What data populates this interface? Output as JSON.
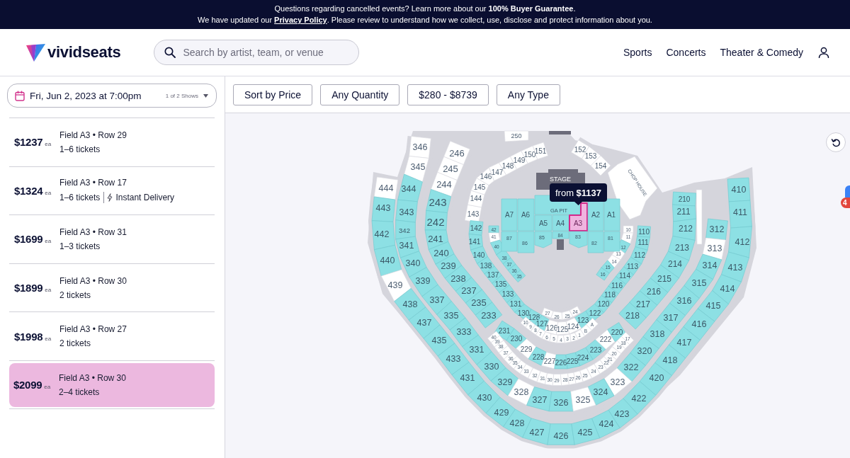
{
  "banner": {
    "message": "Questions regarding cancelled events? Learn more about our **100% Buyer Guarantee**.",
    "notice": {
      "before": "We have updated our ",
      "link": "Privacy Policy",
      "after": ". Please review to understand how we collect, use, disclose and protect information about you."
    }
  },
  "header": {
    "logo": "vividseats",
    "search": {
      "placeholder": "Search by artist, team, or venue"
    },
    "nav": [
      "Sports",
      "Concerts",
      "Theater & Comedy"
    ]
  },
  "event_selector": {
    "date": "Fri, Jun 2, 2023 at 7:00pm",
    "shows": "1 of 2 Shows"
  },
  "listings": [
    {
      "price": "$1237",
      "unit": "ea",
      "seat": "Field A3 • Row 29",
      "quantity": "1–6 tickets",
      "selected": false
    },
    {
      "price": "$1324",
      "unit": "ea",
      "seat": "Field A3 • Row 17",
      "quantity": "1–6 tickets",
      "feature": "Instant Delivery",
      "selected": false
    },
    {
      "price": "$1699",
      "unit": "ea",
      "seat": "Field A3 • Row 31",
      "quantity": "1–3 tickets",
      "selected": false
    },
    {
      "price": "$1899",
      "unit": "ea",
      "seat": "Field A3 • Row 30",
      "quantity": "2 tickets",
      "selected": false
    },
    {
      "price": "$1998",
      "unit": "ea",
      "seat": "Field A3 • Row 27",
      "quantity": "2 tickets",
      "selected": false
    },
    {
      "price": "$2099",
      "unit": "ea",
      "seat": "Field A3 • Row 30",
      "quantity": "2–4 tickets",
      "selected": true
    }
  ],
  "filters": [
    "Sort by Price",
    "Any Quantity",
    "$280 - $8739",
    "Any Type"
  ],
  "seat_map": {
    "levels": [
      {
        "sections": [
          {
            "label": "444",
            "available": false
          },
          {
            "label": "443",
            "available": true
          },
          {
            "label": "442",
            "available": true
          },
          {
            "label": "440",
            "available": true
          },
          {
            "label": "439",
            "available": false
          },
          {
            "label": "438",
            "available": true
          },
          {
            "label": "437",
            "available": true
          },
          {
            "label": "435",
            "available": true
          },
          {
            "label": "433",
            "available": true
          },
          {
            "label": "431",
            "available": true
          },
          {
            "label": "430",
            "available": true
          },
          {
            "label": "429",
            "available": true
          },
          {
            "label": "428",
            "available": true
          },
          {
            "label": "427",
            "available": true
          },
          {
            "label": "426",
            "available": true
          },
          {
            "label": "410",
            "available": true
          },
          {
            "label": "411",
            "available": true
          },
          {
            "label": "412",
            "available": true
          },
          {
            "label": "413",
            "available": true
          },
          {
            "label": "414",
            "available": true
          },
          {
            "label": "415",
            "available": true
          },
          {
            "label": "416",
            "available": true
          },
          {
            "label": "417",
            "available": true
          },
          {
            "label": "418",
            "available": true
          },
          {
            "label": "420",
            "available": true
          },
          {
            "label": "422",
            "available": true
          },
          {
            "label": "423",
            "available": true
          },
          {
            "label": "424",
            "available": true
          },
          {
            "label": "425",
            "available": true
          }
        ]
      },
      {
        "sections": [
          {
            "label": "346",
            "available": false
          },
          {
            "label": "345",
            "available": false
          },
          {
            "label": "344",
            "available": true
          },
          {
            "label": "343",
            "available": true
          },
          {
            "label": "342",
            "available": true
          },
          {
            "label": "341",
            "available": true
          },
          {
            "label": "340",
            "available": true
          },
          {
            "label": "339",
            "available": true
          },
          {
            "label": "337",
            "available": true
          },
          {
            "label": "335",
            "available": true
          },
          {
            "label": "333",
            "available": true
          },
          {
            "label": "331",
            "available": true
          },
          {
            "label": "330",
            "available": true
          },
          {
            "label": "329",
            "available": true
          },
          {
            "label": "328",
            "available": false
          },
          {
            "label": "327",
            "available": true
          },
          {
            "label": "326",
            "available": true
          },
          {
            "label": "312",
            "available": true
          },
          {
            "label": "313",
            "available": false
          },
          {
            "label": "314",
            "available": true
          },
          {
            "label": "315",
            "available": true
          },
          {
            "label": "316",
            "available": true
          },
          {
            "label": "317",
            "available": true
          },
          {
            "label": "318",
            "available": true
          },
          {
            "label": "320",
            "available": true
          },
          {
            "label": "322",
            "available": true
          },
          {
            "label": "323",
            "available": false
          },
          {
            "label": "324",
            "available": true
          },
          {
            "label": "325",
            "available": false
          }
        ]
      },
      {
        "sections": [
          {
            "label": "246",
            "available": false
          },
          {
            "label": "245",
            "available": false
          },
          {
            "label": "244",
            "available": false
          },
          {
            "label": "243",
            "available": true
          },
          {
            "label": "242",
            "available": true
          },
          {
            "label": "241",
            "available": true
          },
          {
            "label": "240",
            "available": true
          },
          {
            "label": "239",
            "available": true
          },
          {
            "label": "238",
            "available": true
          },
          {
            "label": "237",
            "available": true
          },
          {
            "label": "235",
            "available": true
          },
          {
            "label": "233",
            "available": true
          }
        ]
      },
      {
        "sections": [
          {
            "label": "210",
            "available": true
          },
          {
            "label": "211",
            "available": true
          },
          {
            "label": "212",
            "available": true
          },
          {
            "label": "213",
            "available": true
          },
          {
            "label": "214",
            "available": true
          },
          {
            "label": "215",
            "available": true
          },
          {
            "label": "216",
            "available": true
          },
          {
            "label": "217",
            "available": true
          },
          {
            "label": "218",
            "available": true
          }
        ]
      },
      {
        "sections": [
          {
            "label": "143",
            "available": false
          },
          {
            "label": "144",
            "available": false
          },
          {
            "label": "145",
            "available": false
          },
          {
            "label": "146",
            "available": false
          },
          {
            "label": "147",
            "available": false
          },
          {
            "label": "148",
            "available": false
          },
          {
            "label": "149",
            "available": false
          },
          {
            "label": "150",
            "available": false
          },
          {
            "label": "151",
            "available": false
          }
        ]
      },
      {
        "sections": [
          {
            "label": "152",
            "available": false
          },
          {
            "label": "153",
            "available": false
          },
          {
            "label": "154",
            "available": false
          }
        ]
      },
      {
        "sections": [
          {
            "label": "142",
            "available": true
          },
          {
            "label": "141",
            "available": true
          },
          {
            "label": "140",
            "available": true
          },
          {
            "label": "138",
            "available": true
          },
          {
            "label": "137",
            "available": true
          },
          {
            "label": "135",
            "available": true
          },
          {
            "label": "133",
            "available": true
          },
          {
            "label": "131",
            "available": true
          },
          {
            "label": "130",
            "available": true
          },
          {
            "label": "128",
            "available": true
          },
          {
            "label": "127",
            "available": true
          },
          {
            "label": "126",
            "available": false
          },
          {
            "label": "125",
            "available": false
          },
          {
            "label": "110",
            "available": true
          },
          {
            "label": "111",
            "available": true
          },
          {
            "label": "112",
            "available": true
          },
          {
            "label": "113",
            "available": true
          },
          {
            "label": "114",
            "available": true
          },
          {
            "label": "116",
            "available": true
          },
          {
            "label": "118",
            "available": true
          },
          {
            "label": "120",
            "available": true
          },
          {
            "label": "122",
            "available": true
          },
          {
            "label": "123",
            "available": true
          },
          {
            "label": "124",
            "available": false
          }
        ]
      },
      {
        "sections": [
          {
            "label": "42",
            "available": true
          },
          {
            "label": "41",
            "available": false
          },
          {
            "label": "40",
            "available": true
          },
          {
            "label": "38",
            "available": true
          },
          {
            "label": "37",
            "available": true
          },
          {
            "label": "36",
            "available": true
          },
          {
            "label": "35",
            "available": true
          }
        ]
      },
      {
        "sections": [
          {
            "label": "10",
            "available": false
          },
          {
            "label": "11",
            "available": false
          },
          {
            "label": "12",
            "available": true
          },
          {
            "label": "13",
            "available": false
          },
          {
            "label": "14",
            "available": false
          },
          {
            "label": "15",
            "available": true
          },
          {
            "label": "16",
            "available": true
          }
        ]
      },
      {
        "sections": [
          {
            "label": "27",
            "available": false
          },
          {
            "label": "26",
            "available": false
          },
          {
            "label": "25",
            "available": false
          },
          {
            "label": "24",
            "available": false
          }
        ]
      },
      {
        "sections": [
          {
            "label": "10",
            "available": false
          },
          {
            "label": "9",
            "available": false
          },
          {
            "label": "8",
            "available": false
          },
          {
            "label": "7",
            "available": false
          },
          {
            "label": "6",
            "available": false
          },
          {
            "label": "5",
            "available": false
          },
          {
            "label": "4",
            "available": false
          },
          {
            "label": "3",
            "available": false
          },
          {
            "label": "2",
            "available": false
          },
          {
            "label": "1",
            "available": false
          },
          {
            "label": "B",
            "available": false
          },
          {
            "label": "A",
            "available": false
          }
        ]
      },
      {
        "sections": [
          {
            "label": "231",
            "available": true
          },
          {
            "label": "230",
            "available": true
          },
          {
            "label": "229",
            "available": false
          },
          {
            "label": "228",
            "available": true
          },
          {
            "label": "227",
            "available": false
          },
          {
            "label": "226",
            "available": true
          },
          {
            "label": "225",
            "available": true
          },
          {
            "label": "224",
            "available": true
          },
          {
            "label": "223",
            "available": true
          },
          {
            "label": "222",
            "available": false
          },
          {
            "label": "220",
            "available": true
          }
        ]
      },
      {
        "sections": [
          {
            "label": "40",
            "available": false
          },
          {
            "label": "39",
            "available": false
          },
          {
            "label": "38",
            "available": false
          },
          {
            "label": "37",
            "available": false
          },
          {
            "label": "36",
            "available": false
          },
          {
            "label": "35",
            "available": false
          },
          {
            "label": "34",
            "available": false
          },
          {
            "label": "33",
            "available": false
          },
          {
            "label": "32",
            "available": false
          },
          {
            "label": "31",
            "available": false
          },
          {
            "label": "30",
            "available": false
          },
          {
            "label": "29",
            "available": false
          },
          {
            "label": "28",
            "available": false
          },
          {
            "label": "27",
            "available": false
          },
          {
            "label": "26",
            "available": false
          },
          {
            "label": "25",
            "available": false
          },
          {
            "label": "24",
            "available": false
          },
          {
            "label": "23",
            "available": false
          },
          {
            "label": "22",
            "available": false
          },
          {
            "label": "21",
            "available": false
          },
          {
            "label": "20",
            "available": false
          },
          {
            "label": "19",
            "available": false
          },
          {
            "label": "18",
            "available": false
          },
          {
            "label": "17",
            "available": false
          }
        ]
      },
      {
        "sections": [
          {
            "label": "250",
            "available": false
          }
        ]
      }
    ],
    "field": {
      "stage": "STAGE",
      "sections": [
        {
          "label": "GA PIT",
          "available": true,
          "selected": false
        },
        {
          "label": "A7",
          "available": true,
          "selected": false
        },
        {
          "label": "A6",
          "available": true,
          "selected": false
        },
        {
          "label": "A5",
          "available": true,
          "selected": false
        },
        {
          "label": "A4",
          "available": true,
          "selected": false
        },
        {
          "label": "A3",
          "available": true,
          "selected": true
        },
        {
          "label": "A2",
          "available": true,
          "selected": false
        },
        {
          "label": "A1",
          "available": true,
          "selected": false
        },
        {
          "label": "87",
          "available": true,
          "selected": false
        },
        {
          "label": "86",
          "available": true,
          "selected": false
        },
        {
          "label": "85",
          "available": true,
          "selected": false
        },
        {
          "label": "84",
          "available": true,
          "selected": false
        },
        {
          "label": "83",
          "available": true,
          "selected": false
        },
        {
          "label": "82",
          "available": true,
          "selected": false
        },
        {
          "label": "81",
          "available": true,
          "selected": false
        }
      ]
    },
    "chop_house": "CHOP HOUSE",
    "tooltip": "from **$1137**"
  },
  "side_badge": "4"
}
